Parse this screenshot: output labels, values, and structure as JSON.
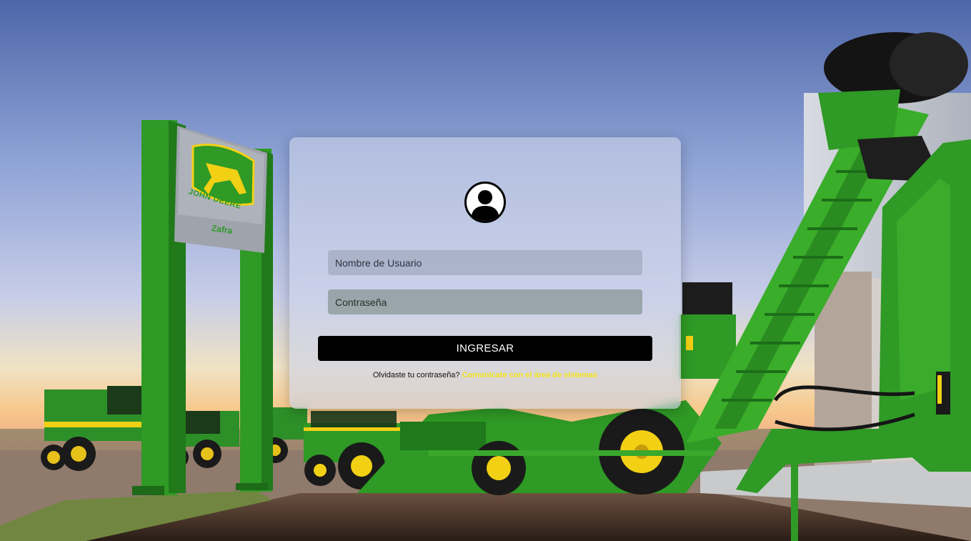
{
  "background": {
    "sign": {
      "brand": "JOHN DEERE",
      "location": "Zafra"
    }
  },
  "login": {
    "username_placeholder": "Nombre de Usuario",
    "username_value": "",
    "password_placeholder": "Contraseña",
    "password_value": "",
    "submit_label": "INGRESAR",
    "forgot_text": "Olvidaste tu contraseña?",
    "forgot_link": "Comunicate con el área de sistemas"
  },
  "colors": {
    "deere_green": "#2f9a25",
    "deere_yellow": "#f2d014",
    "link_yellow": "#f2e21a",
    "button_black": "#000000"
  },
  "icons": {
    "avatar": "user-circle-icon"
  }
}
